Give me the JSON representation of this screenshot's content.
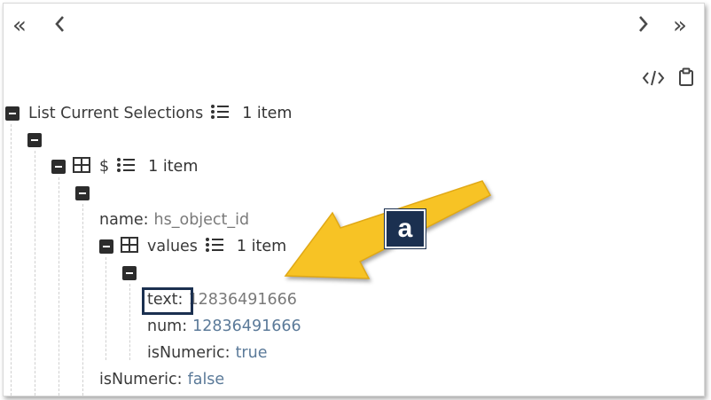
{
  "nav": {
    "first": "«",
    "prev": "‹",
    "next": "›",
    "last": "»"
  },
  "tree": {
    "root_label": "List Current Selections",
    "root_count": "1 item",
    "dollar_label": "$",
    "dollar_count": "1 item",
    "name_key": "name:",
    "name_value": "hs_object_id",
    "values_label": "values",
    "values_count": "1 item",
    "text_key": "text:",
    "text_value": "12836491666",
    "num_key": "num:",
    "num_value": "12836491666",
    "inner_isnumeric_key": "isNumeric:",
    "inner_isnumeric_value": "true",
    "outer_isnumeric_key": "isNumeric:",
    "outer_isnumeric_value": "false"
  },
  "annotation": {
    "badge_label": "a",
    "arrow_color": "#f7c325",
    "badge_color": "#1b3050"
  },
  "icons": [
    "double-chevron-left-icon",
    "chevron-left-icon",
    "chevron-right-icon",
    "double-chevron-right-icon",
    "code-icon",
    "clipboard-icon",
    "collapse-icon",
    "list-icon",
    "table-icon"
  ]
}
